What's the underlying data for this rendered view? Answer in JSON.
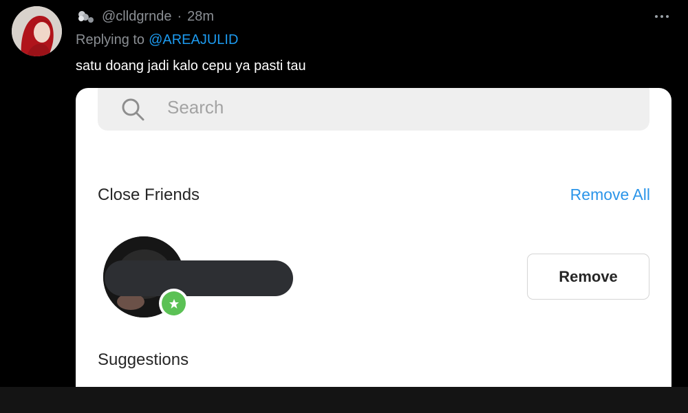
{
  "tweet": {
    "handle": "@clldgrnde",
    "separator": "·",
    "time": "28m",
    "replying_prefix": "Replying to",
    "replying_to": "@AREAJULID",
    "text": "satu doang jadi kalo cepu ya pasti tau",
    "icons": [
      "avatar",
      "handle-emoji-icon",
      "more-options-icon"
    ]
  },
  "screenshot": {
    "search": {
      "placeholder": "Search"
    },
    "close_friends": {
      "title": "Close Friends",
      "remove_all_label": "Remove All",
      "rows": [
        {
          "name_redacted": true,
          "badge": "star-icon",
          "remove_label": "Remove"
        }
      ]
    },
    "suggestions": {
      "title": "Suggestions"
    }
  },
  "colors": {
    "background": "#000000",
    "muted_text": "#8b8f94",
    "link": "#1d9bf0",
    "instagram_blue": "#2b95e9",
    "close_friends_green": "#5bc155"
  }
}
